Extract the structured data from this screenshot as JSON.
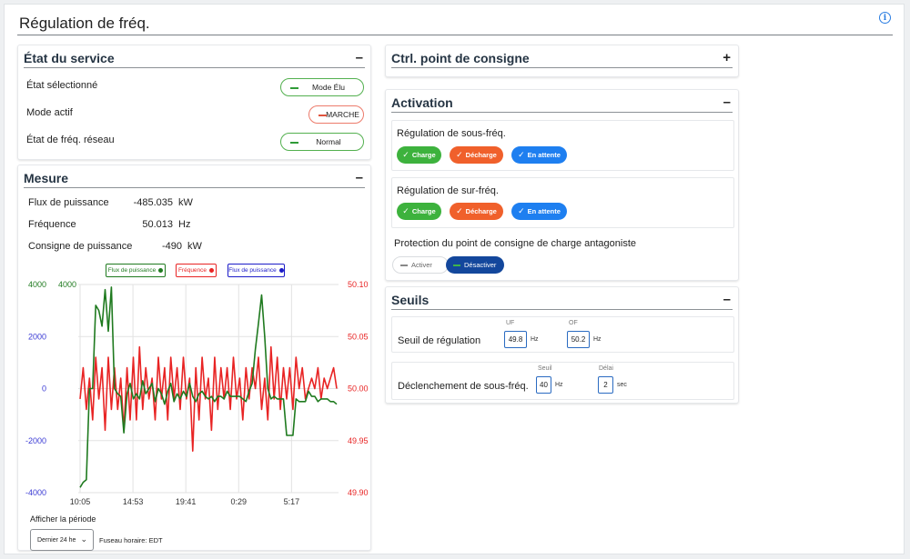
{
  "page": {
    "title": "Régulation de fréq.",
    "info_icon": "info-circle-icon"
  },
  "etat_service": {
    "title": "État du service",
    "toggle": "–",
    "rows": [
      {
        "label": "État sélectionné",
        "value": "Mode Élu",
        "status_color": "#2f9b37"
      },
      {
        "label": "Mode actif",
        "value": "MARCHE",
        "status_color": "#e0533d"
      },
      {
        "label": "État de fréq. réseau",
        "value": "Normal",
        "status_color": "#2f9b37"
      }
    ]
  },
  "mesure": {
    "title": "Mesure",
    "toggle": "–",
    "rows": [
      {
        "label": "Flux de puissance",
        "value": "-485.035",
        "unit": "kW"
      },
      {
        "label": "Fréquence",
        "value": "50.013",
        "unit": "Hz"
      },
      {
        "label": "Consigne de puissance",
        "value": "-490",
        "unit": "kW"
      }
    ],
    "period_label": "Afficher la période",
    "period_value": "Dernier 24 he",
    "timezone": "Fuseau horaire: EDT"
  },
  "chart_data": {
    "type": "line",
    "legend": [
      {
        "name": "Flux de puissance",
        "color": "#1f7a1f"
      },
      {
        "name": "Fréquence",
        "color": "#e82424"
      },
      {
        "name": "Flux de puissance",
        "color": "#1c1cc8"
      }
    ],
    "x_ticks": [
      "10:05",
      "14:53",
      "19:41",
      "0:29",
      "5:17"
    ],
    "y_left": {
      "ticks": [
        "4000",
        "2000",
        "0",
        "-2000",
        "-4000"
      ],
      "range": [
        -4000,
        4000
      ],
      "color": "#3a3ad4",
      "top_label_color": "#1f7a1f",
      "top_label": "4000"
    },
    "y_right": {
      "ticks": [
        "50.10",
        "50.05",
        "50.00",
        "49.95",
        "49.90"
      ],
      "range": [
        49.9,
        50.1
      ],
      "color": "#e82424"
    },
    "series": [
      {
        "name": "Flux de puissance",
        "color": "#1f7a1f",
        "values": [
          -3800,
          -3600,
          -3500,
          0,
          0,
          3200,
          3000,
          2400,
          3800,
          2200,
          3900,
          0,
          -200,
          -300,
          -1700,
          -200,
          200,
          -400,
          -200,
          -400,
          300,
          -200,
          0,
          200,
          -500,
          0,
          -200,
          -600,
          -100,
          200,
          -500,
          -200,
          -400,
          -100,
          -300,
          200,
          -300,
          -500,
          -200,
          -100,
          -300,
          -400,
          -300,
          -500,
          -300,
          -300,
          -400,
          -100,
          -300,
          -300,
          -300,
          -300,
          -400,
          -500,
          -100,
          200,
          1500,
          2500,
          3600,
          2000,
          0,
          -400,
          -300,
          -400,
          -400,
          -400,
          -1800,
          -1800,
          -1800,
          -400,
          -500,
          -500,
          -500,
          -100,
          -300,
          -300,
          -500,
          -400,
          -400,
          -400,
          -500,
          -500,
          -600
        ]
      },
      {
        "name": "Fréquence",
        "color": "#e82424",
        "values": [
          49.99,
          50.02,
          49.98,
          50.01,
          49.97,
          50.03,
          49.99,
          50.02,
          49.96,
          50.03,
          49.98,
          50.02,
          49.98,
          50.01,
          49.96,
          50.02,
          49.97,
          50.03,
          49.97,
          50.04,
          49.98,
          50.02,
          49.99,
          50.01,
          49.97,
          50.03,
          49.99,
          50.02,
          49.97,
          50.03,
          49.99,
          50.02,
          49.98,
          50.03,
          49.99,
          50.01,
          49.94,
          50.02,
          49.97,
          50.03,
          49.99,
          50.01,
          49.96,
          50.03,
          49.98,
          50.02,
          49.99,
          50.02,
          49.98,
          50.03,
          49.99,
          50.01,
          49.97,
          50.02,
          49.99,
          50.02,
          50.0,
          50.03,
          49.98,
          50.01,
          49.97,
          50.04,
          49.99,
          50.03,
          49.98,
          50.02,
          49.99,
          50.02,
          49.98,
          50.03,
          50.0,
          50.02,
          49.99,
          50.0,
          50.01,
          50.0,
          50.02,
          49.99,
          50.01,
          50.0,
          50.01,
          50.02,
          50.0
        ]
      }
    ]
  },
  "ctrl_consigne": {
    "title": "Ctrl. point de consigne",
    "toggle": "+"
  },
  "activation": {
    "title": "Activation",
    "toggle": "–",
    "sous_freq": {
      "title": "Régulation de sous-fréq.",
      "buttons": [
        "Charge",
        "Décharge",
        "En attente"
      ]
    },
    "sur_freq": {
      "title": "Régulation de sur-fréq.",
      "buttons": [
        "Charge",
        "Décharge",
        "En attente"
      ]
    },
    "protection": {
      "title": "Protection du point de consigne de charge antagoniste",
      "off_label": "Activer",
      "on_label": "Désactiver"
    },
    "colors": {
      "charge": "#3db23d",
      "decharge": "#f0602b",
      "attente": "#1e7ff0",
      "active": "#13479c"
    }
  },
  "seuils": {
    "title": "Seuils",
    "toggle": "–",
    "regulation": {
      "title": "Seuil de régulation",
      "uf_label": "UF",
      "uf_value": "49.8",
      "uf_unit": "Hz",
      "of_label": "OF",
      "of_value": "50.2",
      "of_unit": "Hz"
    },
    "declenchement": {
      "title": "Déclenchement de sous-fréq.",
      "seuil_label": "Seuil",
      "seuil_value": "40",
      "seuil_unit": "Hz",
      "delai_label": "Délai",
      "delai_value": "2",
      "delai_unit": "sec"
    }
  }
}
